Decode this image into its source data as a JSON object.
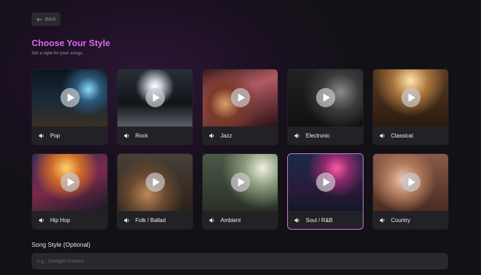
{
  "nav": {
    "back_label": "Back"
  },
  "header": {
    "title": "Choose Your Style",
    "subtitle": "Set a style for your songs."
  },
  "styles": [
    {
      "label": "Pop",
      "selected": false
    },
    {
      "label": "Rock",
      "selected": false
    },
    {
      "label": "Jazz",
      "selected": false
    },
    {
      "label": "Electronic",
      "selected": false
    },
    {
      "label": "Classical",
      "selected": false
    },
    {
      "label": "Hip Hop",
      "selected": false
    },
    {
      "label": "Folk / Ballad",
      "selected": false
    },
    {
      "label": "Ambient",
      "selected": false
    },
    {
      "label": "Soul / R&B",
      "selected": true
    },
    {
      "label": "Country",
      "selected": false
    }
  ],
  "song_style": {
    "label": "Song Style (Optional)",
    "value": "",
    "placeholder": "e.g., Starlight Dreams"
  },
  "colors": {
    "accent": "#d86ae8",
    "selected_border": "#d67ce6",
    "background": "#121115"
  }
}
